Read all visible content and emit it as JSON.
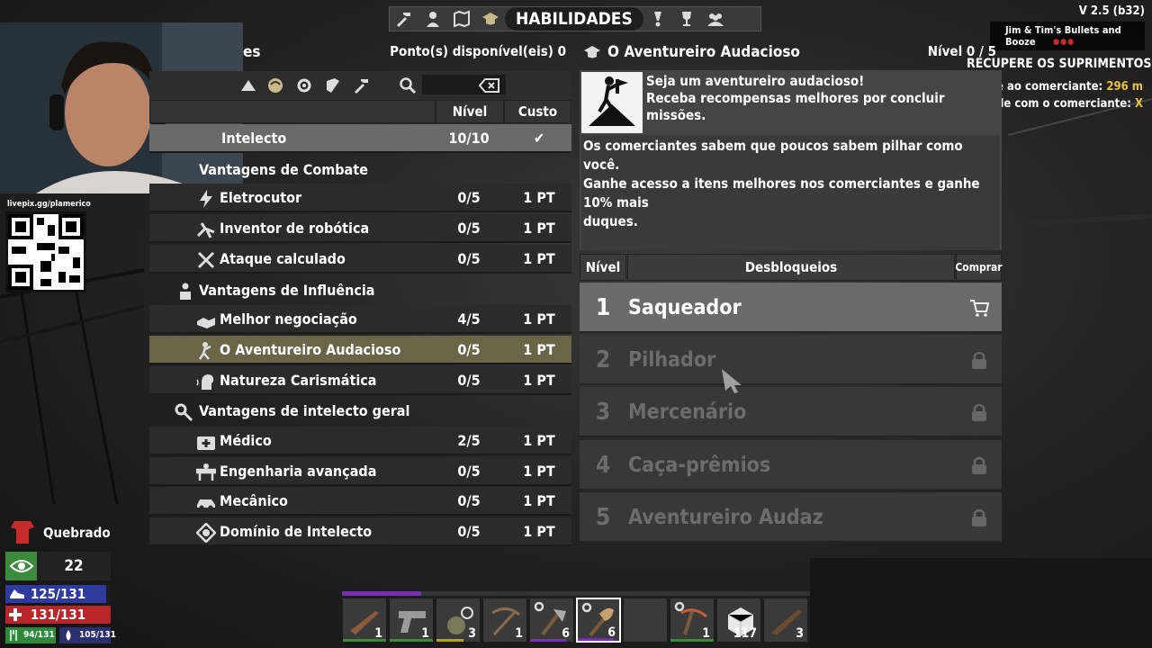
{
  "top_nav": {
    "active_tab": "HABILIDADES",
    "icons": [
      "hammer-icon",
      "character-icon",
      "map-icon",
      "skills-cap-icon",
      "challenges-icon",
      "trophy-icon",
      "players-icon"
    ]
  },
  "version": "V 2.5 (b32)",
  "quest": {
    "title": "Jim & Tim's Bullets and Booze",
    "objective": "RECUPERE OS SUPRIMENTOS",
    "line1_label": "Volte ao comerciante:",
    "line1_value": "296 m",
    "line2_label": "Fale com o comerciante:",
    "line2_value": "X"
  },
  "stream": {
    "livepix_url": "livepix.gg/plamerico"
  },
  "skills_panel": {
    "title_fragment": "es",
    "points_available": "Ponto(s) disponível(eis) 0",
    "columns": {
      "level": "Nível",
      "cost": "Custo"
    },
    "rows": [
      {
        "type": "attribute",
        "label": "Intelecto",
        "level": "10/10",
        "cost": "✔"
      },
      {
        "type": "category",
        "label": "Vantagens de Combate"
      },
      {
        "type": "perk",
        "icon": "lightning-icon",
        "label": "Eletrocutor",
        "level": "0/5",
        "cost": "1 PT"
      },
      {
        "type": "perk",
        "icon": "robot-turret-icon",
        "label": "Inventor de robótica",
        "level": "0/5",
        "cost": "1 PT"
      },
      {
        "type": "perk",
        "icon": "crossed-tools-icon",
        "label": "Ataque calculado",
        "level": "0/5",
        "cost": "1 PT"
      },
      {
        "type": "category",
        "label": "Vantagens de Influência"
      },
      {
        "type": "perk",
        "icon": "handshake-icon",
        "label": "Melhor negociação",
        "level": "4/5",
        "cost": "1 PT"
      },
      {
        "type": "perk",
        "icon": "adventurer-icon",
        "label": "O Aventureiro Audacioso",
        "level": "0/5",
        "cost": "1 PT"
      },
      {
        "type": "perk",
        "icon": "charisma-head-icon",
        "label": "Natureza Carismática",
        "level": "0/5",
        "cost": "1 PT"
      },
      {
        "type": "category",
        "label": "Vantagens de intelecto geral"
      },
      {
        "type": "perk",
        "icon": "medkit-icon",
        "label": "Médico",
        "level": "2/5",
        "cost": "1 PT"
      },
      {
        "type": "perk",
        "icon": "workbench-icon",
        "label": "Engenharia avançada",
        "level": "0/5",
        "cost": "1 PT"
      },
      {
        "type": "perk",
        "icon": "mechanic-car-icon",
        "label": "Mecânico",
        "level": "0/5",
        "cost": "1 PT"
      },
      {
        "type": "perk",
        "icon": "mastery-badge-icon",
        "label": "Domínio de Intelecto",
        "level": "0/5",
        "cost": "1 PT"
      }
    ]
  },
  "perk_detail": {
    "title": "O Aventureiro Audacioso",
    "level": "Nível 0 / 5",
    "short_line1": "Seja um aventureiro audacioso!",
    "short_line2": "Receba recompensas melhores por concluir missões.",
    "long_line1": "Os comerciantes sabem que poucos sabem pilhar como você.",
    "long_line2": "Ganhe acesso a itens melhores nos comerciantes e ganhe 10% mais",
    "long_line3": "duques.",
    "columns": {
      "level": "Nível",
      "unlocks": "Desbloqueios",
      "buy": "Comprar"
    },
    "unlocks": [
      {
        "n": "1",
        "name": "Saqueador",
        "icon": "cart-icon"
      },
      {
        "n": "2",
        "name": "Pilhador",
        "icon": "lock-icon"
      },
      {
        "n": "3",
        "name": "Mercenário",
        "icon": "lock-icon"
      },
      {
        "n": "4",
        "name": "Caça-prêmios",
        "icon": "lock-icon"
      },
      {
        "n": "5",
        "name": "Aventureiro Audaz",
        "icon": "lock-icon"
      }
    ]
  },
  "hud": {
    "status": "Quebrado",
    "visibility": "22",
    "stamina": "125/131",
    "health": "131/131",
    "food": "94/131",
    "water": "105/131",
    "colors": {
      "stamina": "#2d3a9e",
      "health": "#b8262a"
    }
  },
  "toolbelt": {
    "xp_progress": 0.17,
    "slots": [
      {
        "item": "rifle-icon",
        "count": "1"
      },
      {
        "item": "revolver-icon",
        "count": "1"
      },
      {
        "item": "grenade-icon",
        "count": "3"
      },
      {
        "item": "crossbow-icon",
        "count": "1"
      },
      {
        "item": "axe-icon",
        "count": "6"
      },
      {
        "item": "shovel-icon",
        "count": "6"
      },
      {
        "item": "",
        "count": ""
      },
      {
        "item": "pickaxe-icon",
        "count": "1"
      },
      {
        "item": "block-icon",
        "count": "117"
      },
      {
        "item": "shotgun-icon",
        "count": "3"
      }
    ]
  }
}
